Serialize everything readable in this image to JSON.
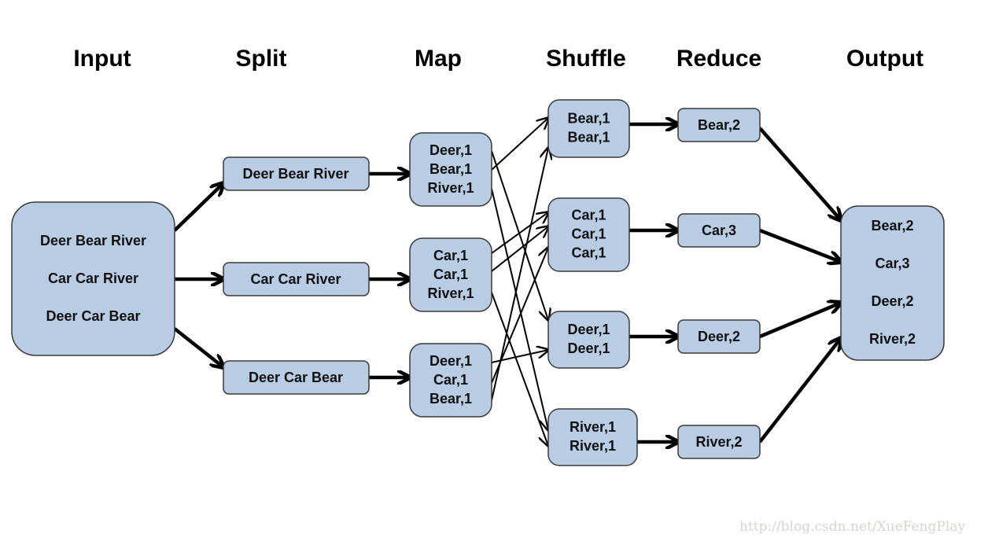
{
  "headers": [
    "Input",
    "Split",
    "Map",
    "Shuffle",
    "Reduce",
    "Output"
  ],
  "input": [
    "Deer Bear River",
    "Car Car River",
    "Deer Car Bear"
  ],
  "split": [
    "Deer Bear River",
    "Car Car River",
    "Deer Car Bear"
  ],
  "map": [
    [
      "Deer,1",
      "Bear,1",
      "River,1"
    ],
    [
      "Car,1",
      "Car,1",
      "River,1"
    ],
    [
      "Deer,1",
      "Car,1",
      "Bear,1"
    ]
  ],
  "shuffle": [
    [
      "Bear,1",
      "Bear,1"
    ],
    [
      "Car,1",
      "Car,1",
      "Car,1"
    ],
    [
      "Deer,1",
      "Deer,1"
    ],
    [
      "River,1",
      "River,1"
    ]
  ],
  "reduce": [
    "Bear,2",
    "Car,3",
    "Deer,2",
    "River,2"
  ],
  "output": [
    "Bear,2",
    "Car,3",
    "Deer,2",
    "River,2"
  ],
  "watermark": "http://blog.csdn.net/XueFengPlay",
  "colors": {
    "box_fill": "#b8cce4",
    "box_stroke": "#3a3a3a",
    "watermark": "#d4d4d0"
  }
}
